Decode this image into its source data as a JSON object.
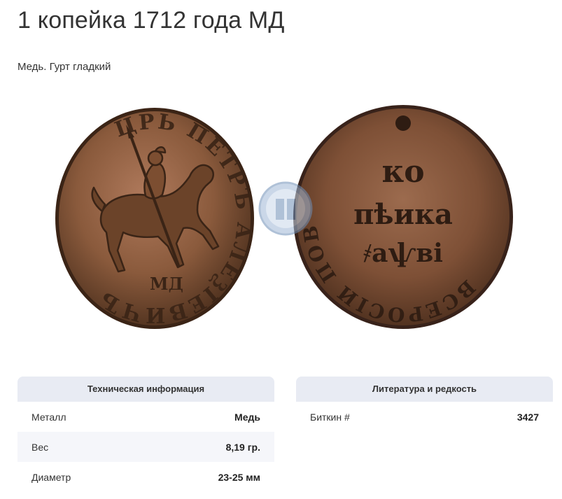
{
  "page": {
    "title": "1 копейка 1712 года МД",
    "subtitle": "Медь. Гурт гладкий"
  },
  "coins": {
    "obverse": {
      "legend": "ЦРЬ ПЕТРЪ АЛЕѮІЕВИЧЪ",
      "mint_mark": "МД"
    },
    "reverse": {
      "top": "ко",
      "middle": "пѣика",
      "bottom": "҂аѱві",
      "legend": "ВСЕРОСІИ ПОВЕЛИТЕЛЬ"
    }
  },
  "technical": {
    "header": "Техническая информация",
    "rows": [
      {
        "label": "Металл",
        "value": "Медь"
      },
      {
        "label": "Вес",
        "value": "8,19 гр."
      },
      {
        "label": "Диаметр",
        "value": "23-25 мм"
      }
    ]
  },
  "literature": {
    "header": "Литература и редкость",
    "rows": [
      {
        "label": "Биткин #",
        "value": "3427"
      }
    ]
  },
  "colors": {
    "copper_dark": "#4a2e1c",
    "copper_mid": "#8a5a3c",
    "copper_light": "#b9866a",
    "card_header_bg": "#e8ebf3",
    "row_alt_bg": "#f5f6fa"
  }
}
